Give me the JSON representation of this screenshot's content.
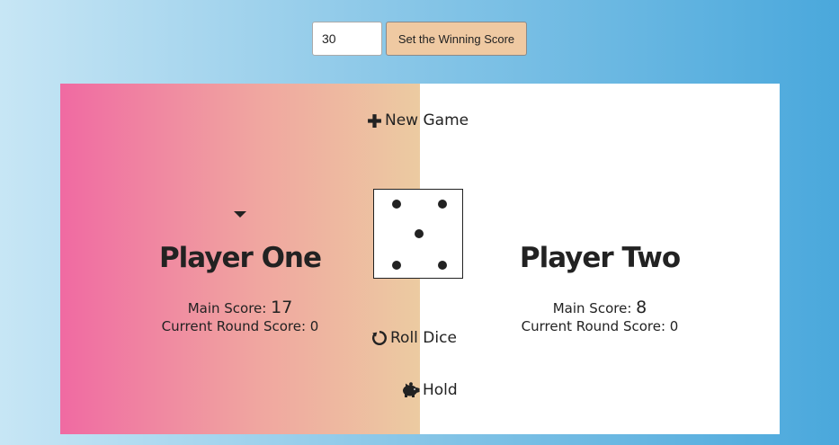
{
  "winning_score": {
    "input_value": "30",
    "button_label": "Set the Winning Score"
  },
  "actions": {
    "new_game": "New Game",
    "roll_dice": "Roll Dice",
    "hold": "Hold"
  },
  "dice": {
    "value": 5
  },
  "players": [
    {
      "name": "Player One",
      "active": true,
      "main_score_label": "Main Score: ",
      "main_score": "17",
      "round_score_text": "Current Round Score: 0"
    },
    {
      "name": "Player Two",
      "active": false,
      "main_score_label": "Main Score: ",
      "main_score": "8",
      "round_score_text": "Current Round Score: 0"
    }
  ],
  "icons": {
    "new_game": "plus-icon",
    "roll_dice": "refresh-icon",
    "hold": "piggy-bank-icon",
    "active_player": "caret-down-icon"
  },
  "colors": {
    "panel_one_start": "#f06aa2",
    "panel_one_end": "#eccba1",
    "button": "#efc9a2",
    "background_start": "#c7e6f5",
    "background_end": "#4aa8dc"
  }
}
